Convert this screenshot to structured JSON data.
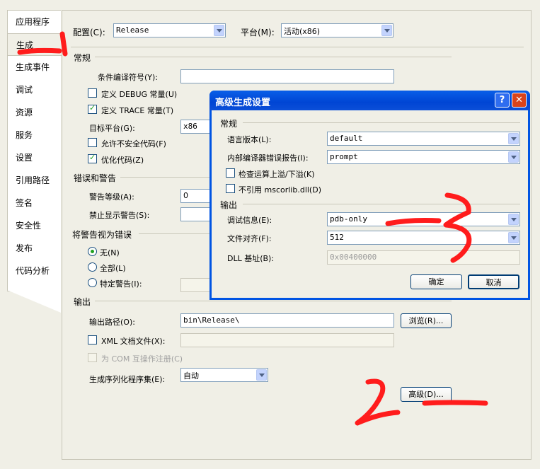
{
  "sidebar": {
    "items": [
      "应用程序",
      "生成",
      "生成事件",
      "调试",
      "资源",
      "服务",
      "设置",
      "引用路径",
      "签名",
      "安全性",
      "发布",
      "代码分析"
    ],
    "active": "生成"
  },
  "top": {
    "config_label": "配置(C):",
    "config_value": "Release",
    "platform_label": "平台(M):",
    "platform_value": "活动(x86)"
  },
  "general": {
    "title": "常规",
    "cond_label": "条件编译符号(Y):",
    "cond_value": "",
    "debug_const": "定义 DEBUG 常量(U)",
    "debug_checked": false,
    "trace_const": "定义 TRACE 常量(T)",
    "trace_checked": true,
    "target_label": "目标平台(G):",
    "target_value": "x86",
    "unsafe": "允许不安全代码(F)",
    "unsafe_checked": false,
    "optimize": "优化代码(Z)",
    "optimize_checked": true
  },
  "errors": {
    "title": "错误和警告",
    "level_label": "警告等级(A):",
    "level_value": "0",
    "suppress_label": "禁止显示警告(S):",
    "suppress_value": ""
  },
  "treat": {
    "title": "将警告视为错误",
    "none": "无(N)",
    "all": "全部(L)",
    "specific": "特定警告(I):",
    "selected": "none"
  },
  "output": {
    "title": "输出",
    "path_label": "输出路径(O):",
    "path_value": "bin\\Release\\",
    "browse": "浏览(R)...",
    "xml": "XML 文档文件(X):",
    "xml_value": "",
    "com": "为 COM 互操作注册(C)",
    "serial_label": "生成序列化程序集(E):",
    "serial_value": "自动",
    "advanced": "高级(D)..."
  },
  "dialog": {
    "title": "高级生成设置",
    "help": "?",
    "close": "✕",
    "general_title": "常规",
    "lang_label": "语言版本(L):",
    "lang_value": "default",
    "report_label": "内部编译器错误报告(I):",
    "report_value": "prompt",
    "overflow": "检查运算上溢/下溢(K)",
    "overflow_checked": false,
    "nomscorlib": "不引用 mscorlib.dll(D)",
    "nomscorlib_checked": false,
    "output_title": "输出",
    "debug_label": "调试信息(E):",
    "debug_value": "pdb-only",
    "align_label": "文件对齐(F):",
    "align_value": "512",
    "dll_label": "DLL 基址(B):",
    "dll_value": "0x00400000",
    "ok": "确定",
    "cancel": "取消"
  },
  "annotations": {
    "ink_color": "#ff1c1c",
    "mark_1": "1",
    "mark_2": "2",
    "mark_3": "3"
  }
}
